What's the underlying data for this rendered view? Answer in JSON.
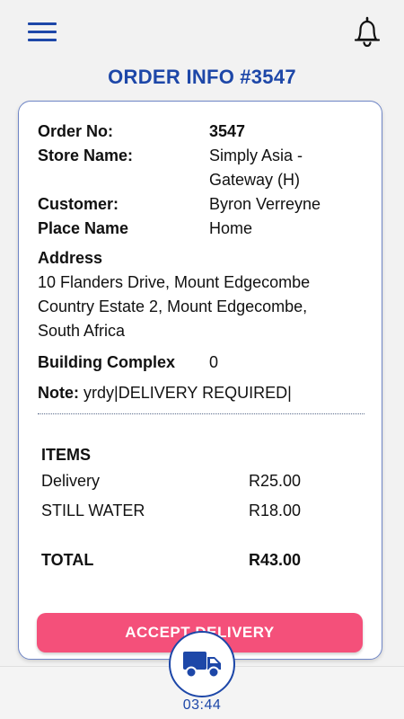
{
  "header": {
    "title": "ORDER INFO",
    "order_ref": "#3547",
    "menu_icon": "hamburger-menu-icon",
    "notification_icon": "bell-icon",
    "accent_color": "#1d47a8"
  },
  "order": {
    "order_no_label": "Order No:",
    "order_no_value": "3547",
    "store_label": "Store Name:",
    "store_value": "Simply Asia - Gateway (H)",
    "customer_label": "Customer:",
    "customer_value": "Byron Verreyne",
    "place_label": "Place Name",
    "place_value": "Home",
    "address_label": "Address",
    "address_value": "10 Flanders Drive, Mount Edgecombe Country Estate 2, Mount Edgecombe, South Africa",
    "building_label": "Building Complex",
    "building_value": "0",
    "note_label": "Note:",
    "note_value": "yrdy|DELIVERY REQUIRED|"
  },
  "items": {
    "heading": "ITEMS",
    "rows": [
      {
        "name": "Delivery",
        "price": "R25.00"
      },
      {
        "name": "STILL WATER",
        "price": "R18.00"
      }
    ],
    "total_label": "TOTAL",
    "total_value": "R43.00"
  },
  "actions": {
    "accept_label": "ACCEPT DELIVERY",
    "accept_color": "#f4507a"
  },
  "footer": {
    "fab_icon": "delivery-truck-icon",
    "timer": "03:44"
  }
}
